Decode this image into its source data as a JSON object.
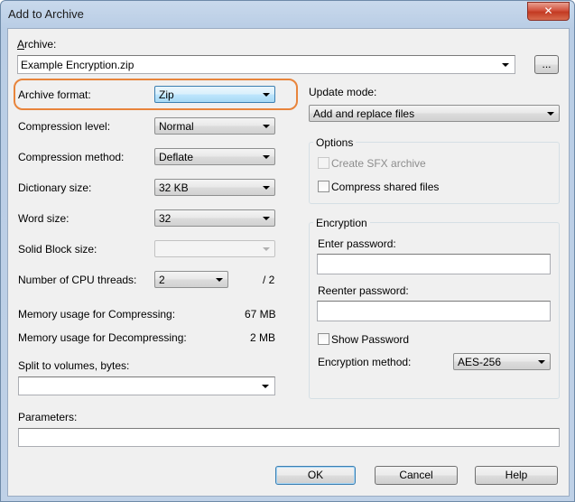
{
  "window": {
    "title": "Add to Archive",
    "close_glyph": "✕"
  },
  "archive": {
    "label": "Archive:",
    "value": "Example Encryption.zip",
    "browse_label": "..."
  },
  "format": {
    "label": "Archive format:",
    "value": "Zip"
  },
  "compression_level": {
    "label": "Compression level:",
    "value": "Normal"
  },
  "compression_method": {
    "label": "Compression method:",
    "value": "Deflate"
  },
  "dictionary_size": {
    "label": "Dictionary size:",
    "value": "32 KB"
  },
  "word_size": {
    "label": "Word size:",
    "value": "32"
  },
  "solid_block": {
    "label": "Solid Block size:",
    "value": ""
  },
  "cpu_threads": {
    "label": "Number of CPU threads:",
    "value": "2",
    "max": "/ 2"
  },
  "memory": {
    "compress_label": "Memory usage for Compressing:",
    "compress_value": "67 MB",
    "decompress_label": "Memory usage for Decompressing:",
    "decompress_value": "2 MB"
  },
  "split": {
    "label": "Split to volumes, bytes:",
    "value": ""
  },
  "parameters": {
    "label": "Parameters:",
    "value": ""
  },
  "update_mode": {
    "label": "Update mode:",
    "value": "Add and replace files"
  },
  "options": {
    "title": "Options",
    "sfx_label": "Create SFX archive",
    "compress_shared_label": "Compress shared files"
  },
  "encryption": {
    "title": "Encryption",
    "enter_password_label": "Enter password:",
    "reenter_password_label": "Reenter password:",
    "show_password_label": "Show Password",
    "method_label": "Encryption method:",
    "method_value": "AES-256"
  },
  "buttons": {
    "ok": "OK",
    "cancel": "Cancel",
    "help": "Help"
  },
  "colors": {
    "highlight_ring": "#e8843b",
    "title_bar": "#bfd1e7",
    "close_button": "#c33a22"
  }
}
